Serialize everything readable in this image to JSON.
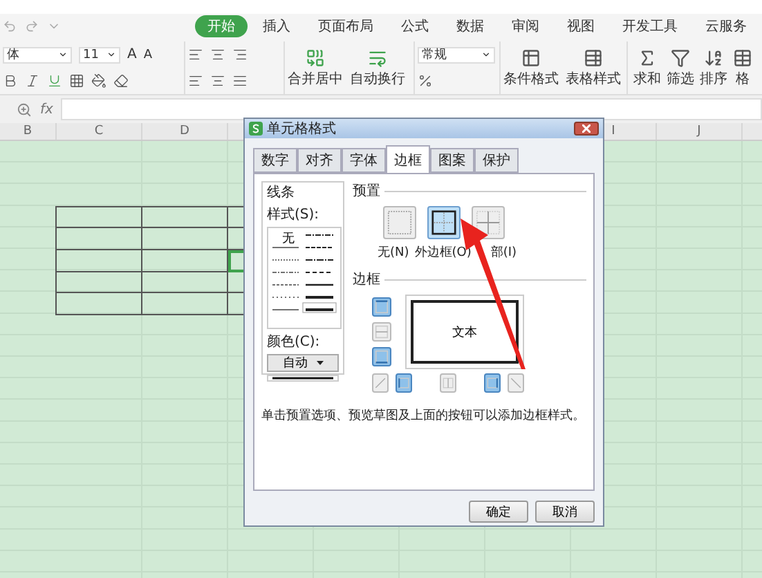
{
  "menu_tabs": [
    {
      "label": "开始",
      "selected": true
    },
    {
      "label": "插入",
      "selected": false
    },
    {
      "label": "页面布局",
      "selected": false
    },
    {
      "label": "公式",
      "selected": false
    },
    {
      "label": "数据",
      "selected": false
    },
    {
      "label": "审阅",
      "selected": false
    },
    {
      "label": "视图",
      "selected": false
    },
    {
      "label": "开发工具",
      "selected": false
    },
    {
      "label": "云服务",
      "selected": false
    }
  ],
  "ribbon": {
    "font_name": "体",
    "font_size": "11",
    "grow_font": "A",
    "shrink_font": "A",
    "merge_label": "合并居中",
    "wrap_label": "自动换行",
    "number_format": "常规",
    "conditional_label": "条件格式",
    "table_style_label": "表格样式",
    "sum_label": "求和",
    "filter_label": "筛选",
    "sort_label": "排序",
    "cut_label": "格"
  },
  "formula_bar": {
    "fx": "fx"
  },
  "columns": [
    {
      "label": "B"
    },
    {
      "label": "C"
    },
    {
      "label": "D"
    },
    {
      "label": "I"
    },
    {
      "label": "J"
    }
  ],
  "dialog": {
    "title": "单元格格式",
    "tabs": [
      {
        "label": "数字",
        "selected": false
      },
      {
        "label": "对齐",
        "selected": false
      },
      {
        "label": "字体",
        "selected": false
      },
      {
        "label": "边框",
        "selected": true
      },
      {
        "label": "图案",
        "selected": false
      },
      {
        "label": "保护",
        "selected": false
      }
    ],
    "line": {
      "title": "线条",
      "style_label": "样式(S):",
      "none_label": "无",
      "color_label": "颜色(C):",
      "color_value": "自动"
    },
    "presets": {
      "title": "预置",
      "items": [
        {
          "kind": "none",
          "label": "无(N)",
          "selected": false
        },
        {
          "kind": "outline",
          "label": "外边框(O)",
          "selected": true
        },
        {
          "kind": "inside",
          "label": "部(I)",
          "selected": false
        }
      ]
    },
    "border": {
      "title": "边框",
      "preview_text": "文本",
      "side_buttons": [
        {
          "kind": "top",
          "selected": true
        },
        {
          "kind": "middle",
          "selected": false
        },
        {
          "kind": "bottom",
          "selected": true
        }
      ],
      "bottom_buttons": [
        {
          "kind": "diag-up",
          "selected": false
        },
        {
          "kind": "left",
          "selected": true
        },
        {
          "kind": "center",
          "selected": false
        },
        {
          "kind": "right",
          "selected": true
        },
        {
          "kind": "diag-down",
          "selected": false
        }
      ]
    },
    "hint": "单击预置选项、预览草图及上面的按钮可以添加边框样式。",
    "buttons": [
      "确定",
      "取消"
    ]
  }
}
